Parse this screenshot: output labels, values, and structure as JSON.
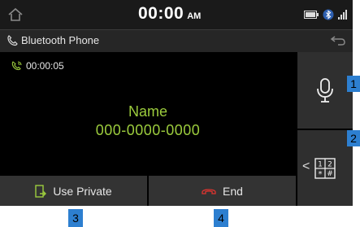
{
  "status_bar": {
    "time": "00:00",
    "ampm": "AM",
    "icons": [
      "home-icon",
      "battery-icon",
      "bluetooth-icon",
      "signal-icon"
    ]
  },
  "header": {
    "title": "Bluetooth Phone",
    "icon": "phone-icon",
    "back_icon": "back-icon"
  },
  "call": {
    "duration": "00:00:05",
    "name": "Name",
    "number": "000-0000-0000"
  },
  "side_buttons": {
    "voice_icon": "microphone-icon",
    "keypad_icon": "keypad-icon",
    "keypad_chevron": "<",
    "keypad_digits": [
      "1",
      "2",
      "*",
      "#"
    ]
  },
  "bottom_buttons": {
    "private_label": "Use Private",
    "end_label": "End"
  },
  "callouts": [
    "1",
    "2",
    "3",
    "4"
  ],
  "colors": {
    "accent_green": "#9ccc3d",
    "end_red": "#e0342f",
    "callout_blue": "#2d7fd0"
  }
}
